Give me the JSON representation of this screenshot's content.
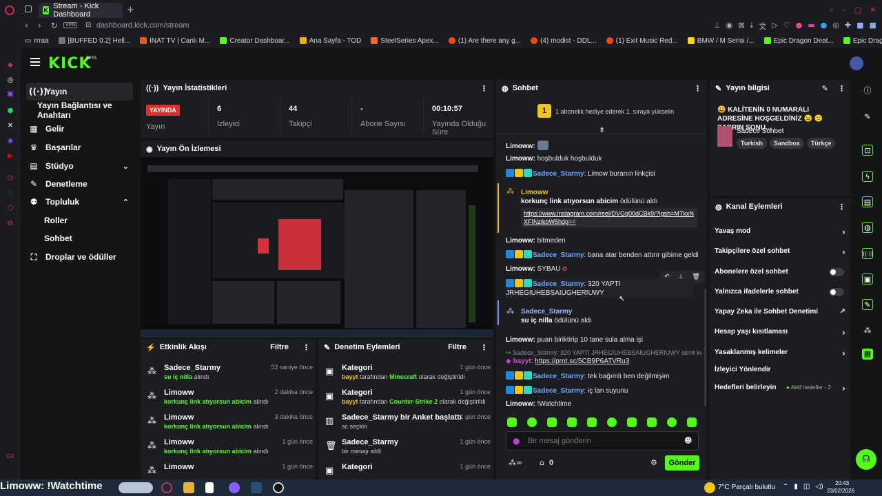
{
  "browser": {
    "tab_title": "Stream - Kick Dashboard",
    "url": "dashboard.kick.com/stream",
    "vpn": "VPN",
    "bookmarks": [
      "rrraa",
      "[BUFFED 0.2] Hell...",
      "INAT TV | Canlı M...",
      "Creator Dashboar...",
      "Ana Sayfa - TOD",
      "SteelSeries Apex...",
      "(1) Are there any g...",
      "(4) modist - DDL...",
      "(1) Exit Music Red...",
      "BMW / M Serisi /...",
      "Epic Dragon Deat...",
      "Epic Dragon Deat..."
    ]
  },
  "brand": {
    "logo": "KICK",
    "beta": "BETA",
    "accent": "#53fc18"
  },
  "nav": {
    "items": [
      {
        "label": "Yayın",
        "icon": "broadcast-icon"
      },
      {
        "label": "Yayın Bağlantısı ve Anahtarı"
      },
      {
        "label": "Gelir",
        "icon": "revenue-icon"
      },
      {
        "label": "Başarılar",
        "icon": "trophy-icon"
      },
      {
        "label": "Stüdyo",
        "icon": "studio-icon"
      },
      {
        "label": "Denetleme",
        "icon": "wrench-icon"
      },
      {
        "label": "Topluluk",
        "icon": "community-icon"
      },
      {
        "label": "Roller"
      },
      {
        "label": "Sohbet"
      },
      {
        "label": "Droplar ve ödüller",
        "icon": "drops-icon"
      }
    ]
  },
  "stats": {
    "title": "Yayın İstatistikleri",
    "live_badge": "YAYINDA",
    "stream_label": "Yayın",
    "viewers": {
      "value": "6",
      "label": "İzleyici"
    },
    "followers": {
      "value": "44",
      "label": "Takipçi"
    },
    "subs": {
      "value": "-",
      "label": "Abone Sayısı"
    },
    "uptime": {
      "value": "00:10:57",
      "label": "Yayında Olduğu Süre"
    }
  },
  "preview": {
    "title": "Yayın Ön İzlemesi"
  },
  "activity": {
    "title": "Etkinlik Akışı",
    "filter": "Filtre",
    "items": [
      {
        "name": "Sadece_Starmy",
        "sub": "su iç nilla",
        "suffix": "alındı",
        "time": "52 saniye önce"
      },
      {
        "name": "Limoww",
        "sub": "korkunç link atıyorsun abicim",
        "suffix": "alındı",
        "time": "2 dakika önce"
      },
      {
        "name": "Limoww",
        "sub": "korkunç link atıyorsun abicim",
        "suffix": "alındı",
        "time": "3 dakika önce"
      },
      {
        "name": "Limoww",
        "sub": "korkunç link atıyorsun abicim",
        "suffix": "alındı",
        "time": "1 gün önce"
      },
      {
        "name": "Limoww",
        "sub": "",
        "suffix": "",
        "time": "1 gün önce"
      }
    ]
  },
  "moderation": {
    "title": "Denetim Eylemleri",
    "filter": "Filtre",
    "items": [
      {
        "title": "Kategori",
        "user": "bayyt",
        "mid": "tarafından",
        "target": "Minecraft",
        "tail": "olarak değiştirildi",
        "time": "1 gün önce"
      },
      {
        "title": "Kategori",
        "user": "bayyt",
        "mid": "tarafından",
        "target": "Counter-Strike 2",
        "tail": "olarak değiştirildi",
        "time": "1 gün önce"
      },
      {
        "title": "Sadece_Starmy bir Anket başlattı",
        "user": "",
        "mid": "sc seçkin",
        "target": "",
        "tail": "",
        "time": "1 gün önce"
      },
      {
        "title": "Sadece_Starmy",
        "user": "",
        "mid": "bir mesajı sildi",
        "target": "",
        "tail": "",
        "time": "1 gün önce"
      },
      {
        "title": "Kategori",
        "user": "",
        "mid": "",
        "target": "",
        "tail": "",
        "time": "1 gün önce"
      }
    ]
  },
  "chat": {
    "title": "Sohbet",
    "gift_number": "1",
    "gift_text": "1 abonelik hediye ederek 1. sıraya yükselin",
    "messages": {
      "m1_user": "Limoww:",
      "m2_user": "Limoww:",
      "m2_text": "hoşbulduk hoşbulduk",
      "m3_user": "Sadece_Starmy",
      "m3_text": ": Limow buranın linkçisi",
      "r1_user": "Limoww",
      "r1_text": "korkunç link atıyorsun abicim",
      "r1_suffix": "ödülünü aldı",
      "r1_link": "https://www.instagram.com/reel/DVGq00dCBk9/?igsh=MTkxNXFINzlkbW5hdg==",
      "m4_user": "Limoww:",
      "m4_text": "bitmeden",
      "m5_user": "Sadece_Starmy",
      "m5_text": ": bana atar benden attırır gibime geldi",
      "m6_user": "Limoww:",
      "m6_text": "SYBAU",
      "m7_user": "Sadece_Starmy",
      "m7_text": ": 320 YAPTI JRHEGIUHEBSAIUGHERIUWY",
      "r2_user": "Sadece_Starmy",
      "r2_text": "su iç nilla",
      "r2_suffix": "ödülünü aldı",
      "m8_user": "Limoww:",
      "m8_text": "puan biriktirip 10 tane sula alma işi",
      "reply_text": "Sadece_Starmy: 320 YAPTI JRHEGIUHEBSAIUGHERIUWY isimli kull...",
      "m9_user": "bayyt",
      "m9_text": "https://prnt.sc/5CB9P6ATVRu3",
      "m10_user": "Sadece_Starmy",
      "m10_text": ": tek bağımlı ben değilmişim",
      "m11_user": "Sadece_Starmy",
      "m11_text": ": iç lan suyunu",
      "m12_user": "Limoww:",
      "m12_text": "!Watchtime"
    },
    "input_placeholder": "Bir mesaj gönderin",
    "points": "0",
    "send": "Gönder"
  },
  "info": {
    "title": "Yayın bilgisi",
    "stream_title": "😀 KALİTENİN 0 NUMARALI ADRESİNE HOŞGELDİNİZ 😉 🙂 SABRIN SONU...",
    "category": "Sadece Sohbet",
    "tags": [
      "Turkish",
      "Sandbox",
      "Türkçe"
    ]
  },
  "actions": {
    "title": "Kanal Eylemleri",
    "items": [
      "Yavaş mod",
      "Takipçilere özel sohbet",
      "Abonelere özel sohbet",
      "Yalnızca ifadelerle sohbet",
      "Yapay Zeka ile Sohbet Denetimi",
      "Hesap yaşı kısıtlaması",
      "Yasaklanmış kelimeler",
      "İzleyici Yönlendir",
      "Hedefleri belirleyin"
    ],
    "goals_badge": "Aktif hedefler - 2"
  },
  "taskbar": {
    "overlay_text": "Limoww: !Watchtime",
    "weather": "7°C  Parçalı bulutlu",
    "time": "20:43",
    "date": "23/02/2026"
  }
}
